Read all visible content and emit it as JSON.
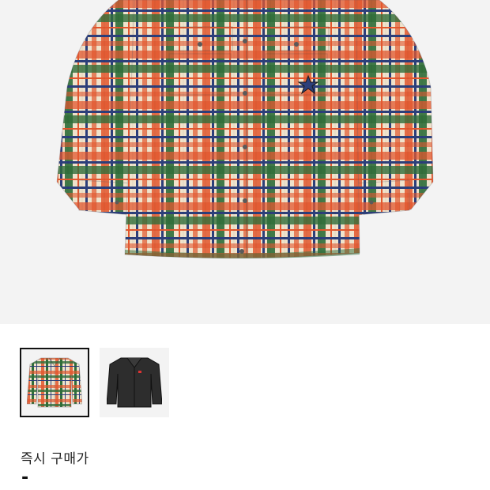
{
  "product": {
    "main_image": "plaid-corduroy-shirt",
    "thumbnails": [
      {
        "image": "plaid-shirt-thumbnail",
        "selected": true
      },
      {
        "image": "black-jacket-thumbnail",
        "selected": false
      }
    ]
  },
  "pricing": {
    "instant_buy_label": "즉시 구매가",
    "instant_buy_value": "-"
  },
  "colors": {
    "background": "#ffffff",
    "image_bg": "#f3f3f3",
    "plaid_cream": "#efe3cc",
    "plaid_red": "#e2572e",
    "plaid_green": "#2f6e3a",
    "plaid_navy": "#2c3f7a",
    "selected_border": "#111111"
  }
}
